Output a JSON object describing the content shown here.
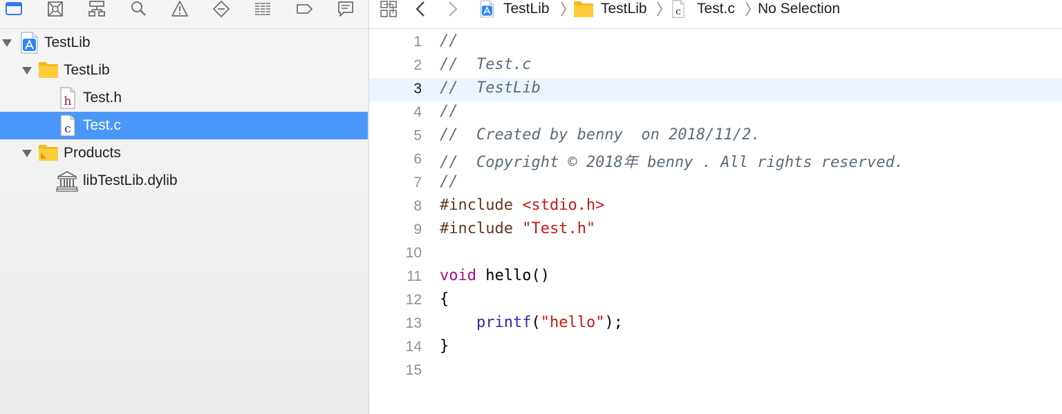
{
  "navigator": {
    "toolbar_icons": [
      "project-navigator-icon",
      "source-control-icon",
      "symbol-navigator-icon",
      "find-icon",
      "issue-icon",
      "test-icon",
      "debug-icon",
      "breakpoint-icon",
      "report-icon"
    ],
    "tree": [
      {
        "label": "TestLib",
        "kind": "project",
        "expanded": true,
        "depth": 0
      },
      {
        "label": "TestLib",
        "kind": "folder",
        "expanded": true,
        "depth": 1
      },
      {
        "label": "Test.h",
        "kind": "header-file",
        "depth": 2
      },
      {
        "label": "Test.c",
        "kind": "c-file",
        "depth": 2,
        "selected": true
      },
      {
        "label": "Products",
        "kind": "folder",
        "expanded": true,
        "depth": 1
      },
      {
        "label": "libTestLib.dylib",
        "kind": "library",
        "depth": 2
      }
    ]
  },
  "jumpbar": {
    "project": "TestLib",
    "group": "TestLib",
    "file": "Test.c",
    "symbol": "No Selection"
  },
  "editor": {
    "current_line": 3,
    "lines": [
      {
        "n": "1",
        "tokens": [
          {
            "t": "comment",
            "v": "//"
          }
        ]
      },
      {
        "n": "2",
        "tokens": [
          {
            "t": "comment",
            "v": "//  Test.c"
          }
        ]
      },
      {
        "n": "3",
        "tokens": [
          {
            "t": "comment",
            "v": "//  TestLib"
          }
        ]
      },
      {
        "n": "4",
        "tokens": [
          {
            "t": "comment",
            "v": "//"
          }
        ]
      },
      {
        "n": "5",
        "tokens": [
          {
            "t": "comment",
            "v": "//  Created by benny  on 2018/11/2."
          }
        ]
      },
      {
        "n": "6",
        "tokens": [
          {
            "t": "comment",
            "v": "//  Copyright © 2018年 benny . All rights reserved."
          }
        ]
      },
      {
        "n": "7",
        "tokens": [
          {
            "t": "comment",
            "v": "//"
          }
        ]
      },
      {
        "n": "8",
        "tokens": [
          {
            "t": "preproc",
            "v": "#include "
          },
          {
            "t": "string",
            "v": "<stdio.h>"
          }
        ]
      },
      {
        "n": "9",
        "tokens": [
          {
            "t": "preproc",
            "v": "#include "
          },
          {
            "t": "string",
            "v": "\"Test.h\""
          }
        ]
      },
      {
        "n": "10",
        "tokens": []
      },
      {
        "n": "11",
        "tokens": [
          {
            "t": "keyword",
            "v": "void"
          },
          {
            "t": "plain",
            "v": " hello()"
          }
        ]
      },
      {
        "n": "12",
        "tokens": [
          {
            "t": "plain",
            "v": "{"
          }
        ]
      },
      {
        "n": "13",
        "tokens": [
          {
            "t": "plain",
            "v": "    "
          },
          {
            "t": "func",
            "v": "printf"
          },
          {
            "t": "plain",
            "v": "("
          },
          {
            "t": "string",
            "v": "\"hello\""
          },
          {
            "t": "plain",
            "v": ");"
          }
        ]
      },
      {
        "n": "14",
        "tokens": [
          {
            "t": "plain",
            "v": "}"
          }
        ]
      },
      {
        "n": "15",
        "tokens": []
      }
    ]
  },
  "colors": {
    "selection": "#4a97f9",
    "current_line": "#ecf5ff",
    "comment": "#5d6c79",
    "preproc": "#643820",
    "string": "#c41a16",
    "keyword": "#aa0d91",
    "function": "#3f1fa8"
  }
}
